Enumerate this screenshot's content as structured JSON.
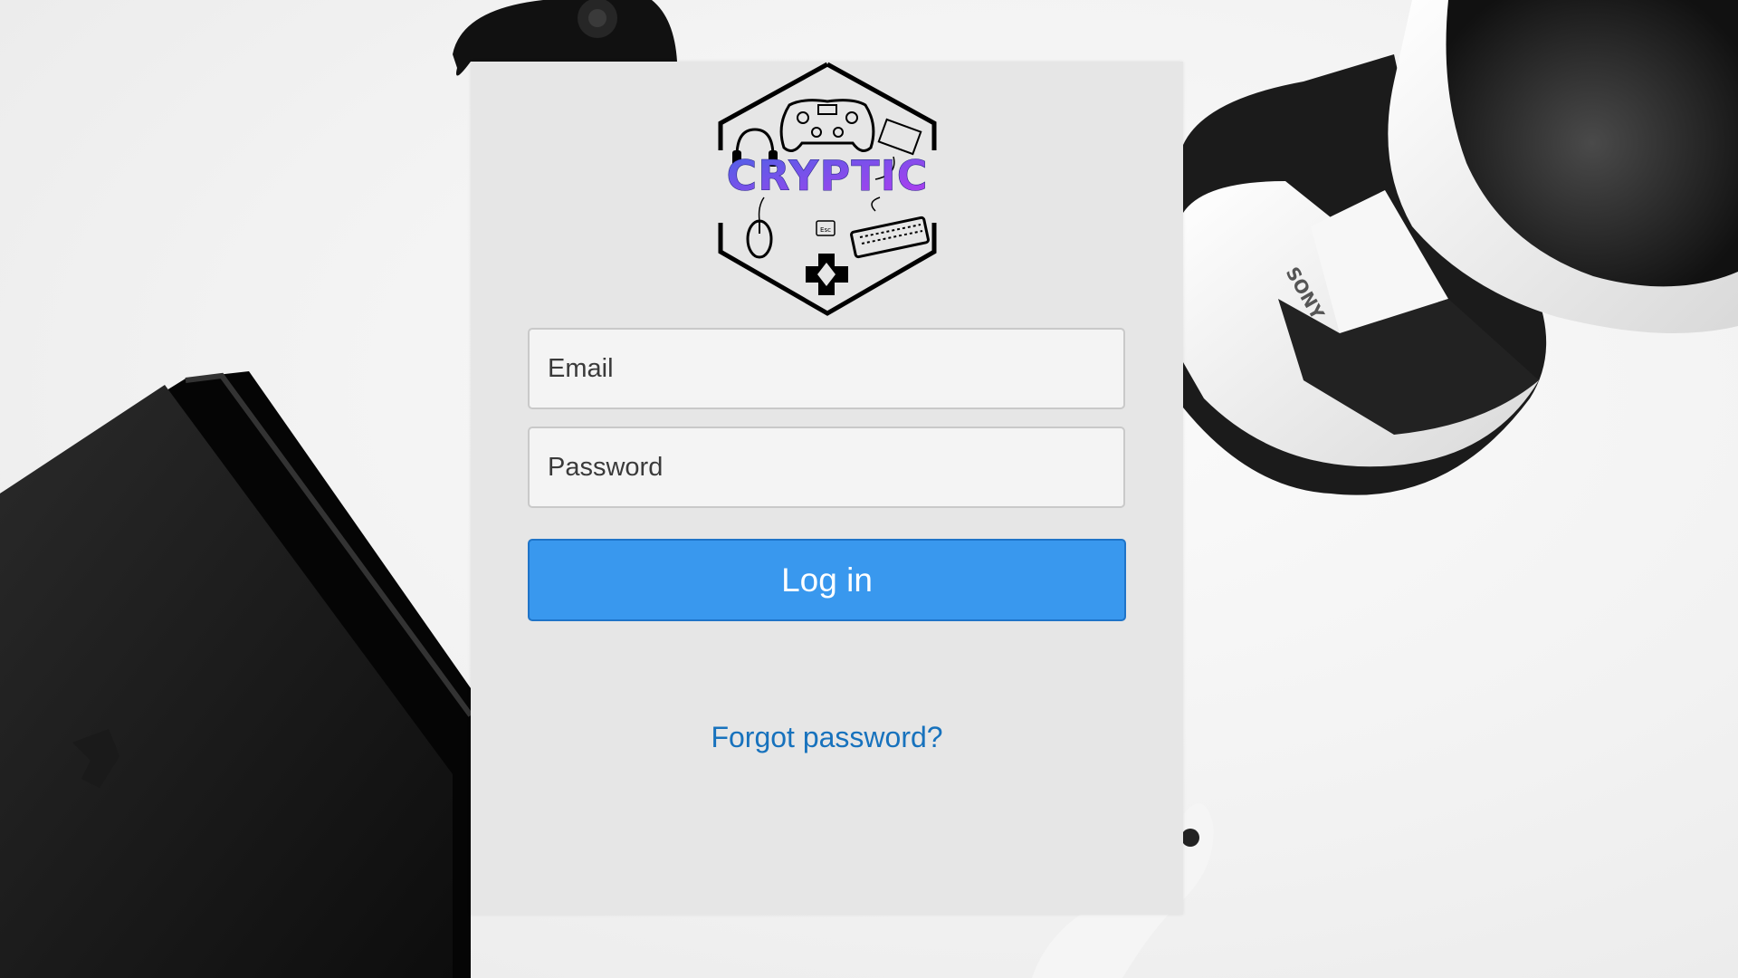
{
  "logo": {
    "text": "CRYPTIC",
    "icons": [
      "headphones-icon",
      "gamepad-icon",
      "tablet-icon",
      "mouse-icon",
      "esc-key-icon",
      "keyboard-icon",
      "dpad-icon"
    ],
    "esc_label": "Esc"
  },
  "form": {
    "email_placeholder": "Email",
    "password_placeholder": "Password",
    "login_label": "Log in",
    "forgot_label": "Forgot password?"
  },
  "background": {
    "headset_brand": "SONY"
  },
  "colors": {
    "accent": "#3998ee",
    "link": "#1772bd",
    "card": "#e6e6e6",
    "logo_gradient_start": "#4b63e6",
    "logo_gradient_end": "#b53af0"
  }
}
